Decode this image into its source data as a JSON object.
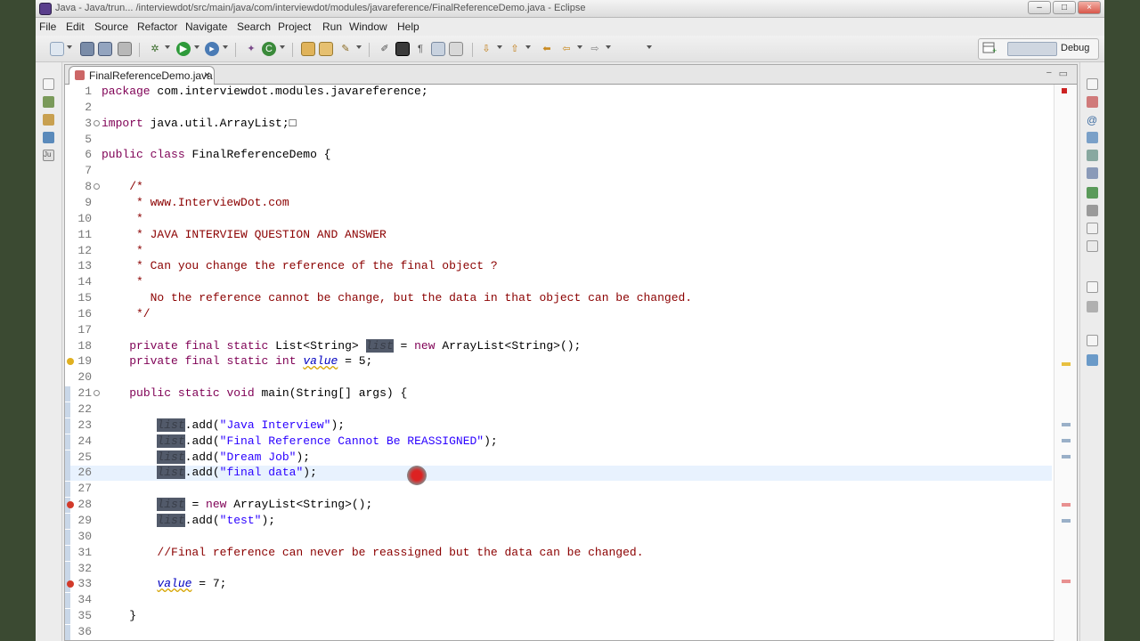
{
  "window": {
    "title": "Java - Java/trun... /interviewdot/src/main/java/com/interviewdot/modules/javareference/FinalReferenceDemo.java - Eclipse"
  },
  "menu": [
    "File",
    "Edit",
    "Source",
    "Refactor",
    "Navigate",
    "Search",
    "Project",
    "Run",
    "Window",
    "Help"
  ],
  "perspective": {
    "debug_label": "Debug"
  },
  "editor_tab": {
    "label": "FinalReferenceDemo.java",
    "close": "×"
  },
  "code_lines": [
    {
      "n": "1",
      "text": "package com.interviewdot.modules.javareference;"
    },
    {
      "n": "2",
      "text": ""
    },
    {
      "n": "3",
      "text": "import java.util.ArrayList;□"
    },
    {
      "n": "5",
      "text": ""
    },
    {
      "n": "6",
      "text": "public class FinalReferenceDemo {"
    },
    {
      "n": "7",
      "text": ""
    },
    {
      "n": "8",
      "text": "    /*"
    },
    {
      "n": "9",
      "text": "     * www.InterviewDot.com"
    },
    {
      "n": "10",
      "text": "     *"
    },
    {
      "n": "11",
      "text": "     * JAVA INTERVIEW QUESTION AND ANSWER"
    },
    {
      "n": "12",
      "text": "     *"
    },
    {
      "n": "13",
      "text": "     * Can you change the reference of the final object ?"
    },
    {
      "n": "14",
      "text": "     *"
    },
    {
      "n": "15",
      "text": "       No the reference cannot be change, but the data in that object can be changed."
    },
    {
      "n": "16",
      "text": "     */"
    },
    {
      "n": "17",
      "text": ""
    },
    {
      "n": "18",
      "text": "    private final static List<String> list = new ArrayList<String>();"
    },
    {
      "n": "19",
      "text": "    private final static int value = 5;"
    },
    {
      "n": "20",
      "text": ""
    },
    {
      "n": "21",
      "text": "    public static void main(String[] args) {"
    },
    {
      "n": "22",
      "text": ""
    },
    {
      "n": "23",
      "text": "        list.add(\"Java Interview\");"
    },
    {
      "n": "24",
      "text": "        list.add(\"Final Reference Cannot Be REASSIGNED\");"
    },
    {
      "n": "25",
      "text": "        list.add(\"Dream Job\");"
    },
    {
      "n": "26",
      "text": "        list.add(\"final data\");"
    },
    {
      "n": "27",
      "text": ""
    },
    {
      "n": "28",
      "text": "        list = new ArrayList<String>();"
    },
    {
      "n": "29",
      "text": "        list.add(\"test\");"
    },
    {
      "n": "30",
      "text": ""
    },
    {
      "n": "31",
      "text": "        //Final reference can never be reassigned but the data can be changed."
    },
    {
      "n": "32",
      "text": ""
    },
    {
      "n": "33",
      "text": "        value = 7;"
    },
    {
      "n": "34",
      "text": ""
    },
    {
      "n": "35",
      "text": "    }"
    },
    {
      "n": "36",
      "text": ""
    }
  ]
}
